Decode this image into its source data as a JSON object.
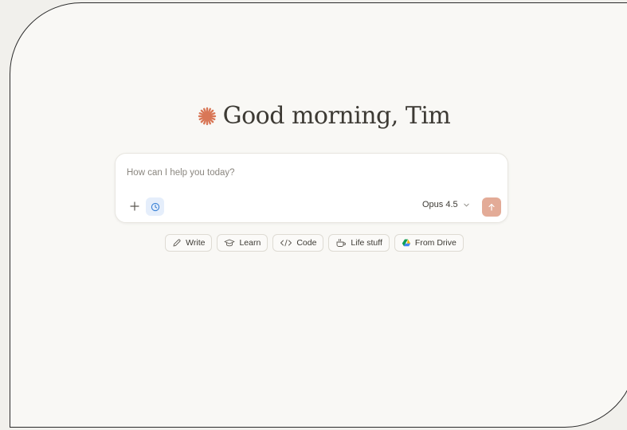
{
  "greeting": "Good morning, Tim",
  "composer": {
    "placeholder": "How can I help you today?",
    "model": "Opus 4.5"
  },
  "icons": {
    "logo": "sparkle-icon",
    "add": "plus-icon",
    "history": "clock-icon",
    "model_dropdown": "chevron-down-icon",
    "send": "arrow-up-icon"
  },
  "chips": [
    {
      "label": "Write",
      "icon": "pencil-icon"
    },
    {
      "label": "Learn",
      "icon": "graduation-cap-icon"
    },
    {
      "label": "Code",
      "icon": "code-icon"
    },
    {
      "label": "Life stuff",
      "icon": "coffee-cup-icon"
    },
    {
      "label": "From Drive",
      "icon": "google-drive-icon"
    }
  ],
  "colors": {
    "background": "#f9f8f5",
    "accent": "#d97757",
    "send_button": "#e3ab97",
    "history_button": "#e5eefb"
  }
}
